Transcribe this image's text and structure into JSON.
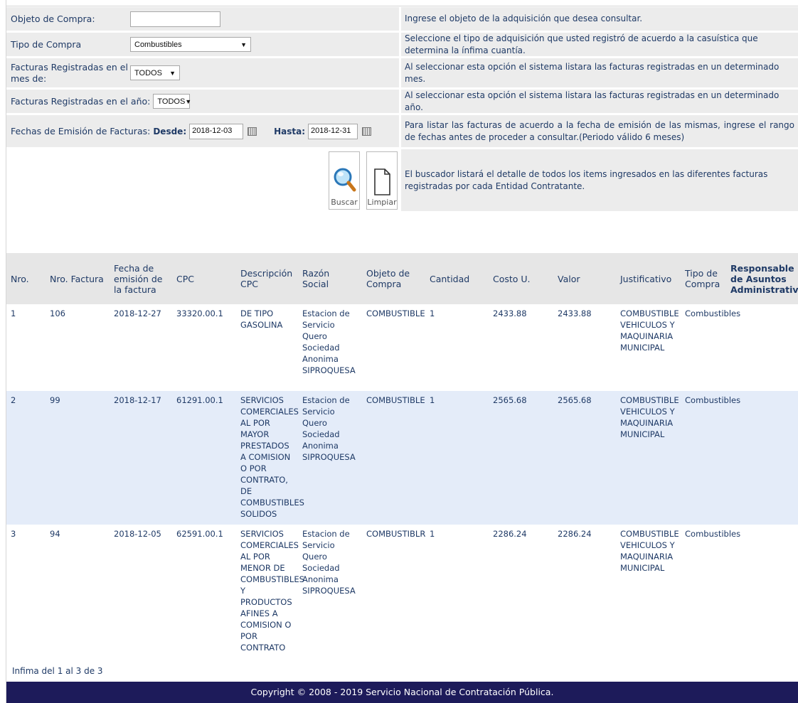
{
  "form": {
    "objeto": {
      "label": "Objeto de Compra:",
      "value": "",
      "help": "Ingrese el objeto de la adquisición que desea consultar."
    },
    "tipo": {
      "label": "Tipo de Compra",
      "selected": "Combustibles",
      "help": "Seleccione el tipo de adquisición que usted registró de acuerdo a la casuística que determina la ínfima cuantía."
    },
    "mes": {
      "label": "Facturas Registradas en el mes de:",
      "selected": "TODOS",
      "help": "Al seleccionar esta opción el sistema listara las facturas registradas en un determinado mes."
    },
    "anio": {
      "label": "Facturas Registradas en el año:",
      "selected": "TODOS",
      "help": "Al seleccionar esta opción el sistema listara las facturas registradas en un determinado año."
    },
    "fechas": {
      "label": "Fechas de Emisión de Facturas:",
      "desde_label": "Desde:",
      "desde": "2018-12-03",
      "hasta_label": "Hasta:",
      "hasta": "2018-12-31",
      "help": "Para listar las facturas de acuerdo a la fecha de emisión de las mismas, ingrese el rango de fechas antes de proceder a consultar.(Periodo válido 6 meses)"
    },
    "buttons": {
      "buscar": "Buscar",
      "limpiar": "Limpiar",
      "help": "El buscador listará el detalle de todos los items ingresados en las diferentes facturas registradas por cada Entidad Contratante."
    }
  },
  "table": {
    "headers": [
      "Nro.",
      "Nro. Factura",
      "Fecha de emisión de la factura",
      "CPC",
      "Descripción CPC",
      "Razón Social",
      "Objeto de Compra",
      "Cantidad",
      "Costo U.",
      "Valor",
      "Justificativo",
      "Tipo de Compra",
      "Responsable de Asuntos Administrativos"
    ],
    "rows": [
      [
        "1",
        "106",
        "2018-12-27",
        "33320.00.1",
        "DE TIPO GASOLINA",
        "Estacion de Servicio Quero Sociedad Anonima SIPROQUESA",
        "COMBUSTIBLE",
        "1",
        "2433.88",
        "2433.88",
        "COMBUSTIBLE VEHICULOS Y MAQUINARIA MUNICIPAL",
        "Combustibles",
        ""
      ],
      [
        "2",
        "99",
        "2018-12-17",
        "61291.00.1",
        "SERVICIOS COMERCIALES AL POR MAYOR PRESTADOS A COMISION O POR CONTRATO, DE COMBUSTIBLES SOLIDOS",
        "Estacion de Servicio Quero Sociedad Anonima SIPROQUESA",
        "COMBUSTIBLE",
        "1",
        "2565.68",
        "2565.68",
        "COMBUSTIBLE VEHICULOS Y MAQUINARIA MUNICIPAL",
        "Combustibles",
        ""
      ],
      [
        "3",
        "94",
        "2018-12-05",
        "62591.00.1",
        "SERVICIOS COMERCIALES AL POR MENOR DE COMBUSTIBLES Y PRODUCTOS AFINES A COMISION O POR CONTRATO",
        "Estacion de Servicio Quero Sociedad Anonima SIPROQUESA",
        "COMBUSTIBLR",
        "1",
        "2286.24",
        "2286.24",
        "COMBUSTIBLE VEHICULOS Y MAQUINARIA MUNICIPAL",
        "Combustibles",
        ""
      ]
    ]
  },
  "summary": "Infima del 1 al 3 de 3",
  "footer": "Copyright © 2008 - 2019 Servicio Nacional de Contratación Pública."
}
